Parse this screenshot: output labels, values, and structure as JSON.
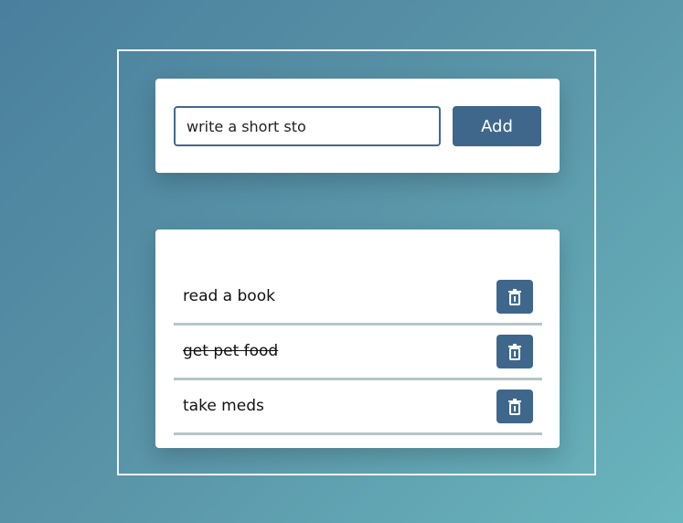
{
  "input_card": {
    "input_value": "write a short sto",
    "add_label": "Add"
  },
  "tasks": [
    {
      "label": "read a book",
      "completed": false,
      "delete_icon": "trash-icon"
    },
    {
      "label": "get pet food",
      "completed": true,
      "delete_icon": "trash-icon"
    },
    {
      "label": "take meds",
      "completed": false,
      "delete_icon": "trash-icon"
    }
  ],
  "colors": {
    "accent": "#3f678b",
    "divider": "#b7c4c8"
  }
}
